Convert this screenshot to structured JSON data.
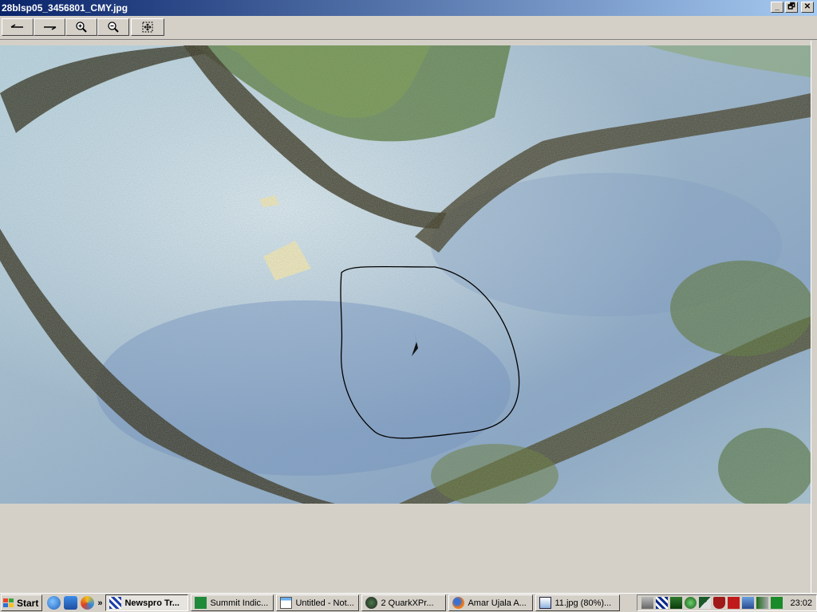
{
  "window": {
    "title": "28blsp05_3456801_CMY.jpg",
    "controls": {
      "minimize": "_",
      "maximize": "🗗",
      "close": "✕"
    }
  },
  "toolbar": {
    "buttons": [
      {
        "name": "previous-button",
        "icon": "arrow-left-icon"
      },
      {
        "name": "next-button",
        "icon": "arrow-right-icon"
      },
      {
        "name": "zoom-in-button",
        "icon": "zoom-in-icon"
      },
      {
        "name": "zoom-out-button",
        "icon": "zoom-out-icon"
      },
      {
        "name": "fit-to-window-button",
        "icon": "fit-window-icon"
      }
    ]
  },
  "taskbar": {
    "start_label": "Start",
    "more_label": "»",
    "tasks": [
      {
        "label": "Newspro Tr...",
        "icon": "newspro-icon",
        "active": true
      },
      {
        "label": "Summit Indic...",
        "icon": "summit-icon",
        "active": false
      },
      {
        "label": "Untitled - Not...",
        "icon": "notepad-icon",
        "active": false
      },
      {
        "label": "2 QuarkXPr...",
        "icon": "quark-icon",
        "active": false
      },
      {
        "label": "Amar Ujala A...",
        "icon": "firefox-icon",
        "active": false
      },
      {
        "label": "11.jpg (80%)...",
        "icon": "image-viewer-icon",
        "active": false
      }
    ],
    "clock": "23:02"
  },
  "colors": {
    "title_gradient_start": "#0a246a",
    "title_gradient_end": "#a6caf0",
    "chrome": "#d4d0c8"
  }
}
